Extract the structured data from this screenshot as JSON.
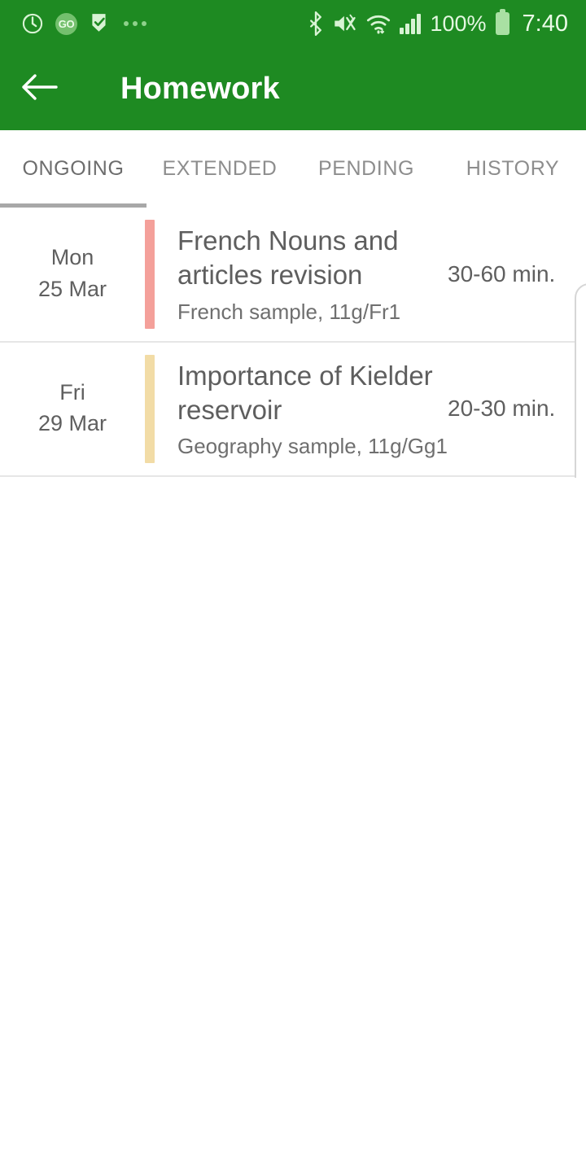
{
  "status_bar": {
    "left_icons": [
      {
        "name": "alarm-circle-icon",
        "glyph": "◎"
      },
      {
        "name": "go-badge-icon",
        "label": "GO"
      },
      {
        "name": "check-flag-icon",
        "glyph": "▶"
      },
      {
        "name": "more-dots-icon",
        "glyph": "•••"
      }
    ],
    "right_icons": [
      {
        "name": "bluetooth-icon",
        "glyph": "᛭"
      },
      {
        "name": "mute-vibrate-icon",
        "glyph": "🔇"
      },
      {
        "name": "wifi-icon",
        "glyph": "wifi"
      },
      {
        "name": "signal-bars-icon",
        "glyph": "bars"
      }
    ],
    "battery_percent": "100%",
    "time": "7:40"
  },
  "app_bar": {
    "back_label": "←",
    "title": "Homework"
  },
  "tabs": [
    {
      "label": "ONGOING",
      "active": true
    },
    {
      "label": "EXTENDED",
      "active": false
    },
    {
      "label": "PENDING",
      "active": false
    },
    {
      "label": "HISTORY",
      "active": false
    }
  ],
  "homework": [
    {
      "day": "Mon",
      "date": "25 Mar",
      "color": "#f4a09a",
      "title": "French Nouns and articles revision",
      "subtitle": "French sample, 11g/Fr1",
      "duration": "30-60 min."
    },
    {
      "day": "Fri",
      "date": "29 Mar",
      "color": "#f2dca6",
      "title": "Importance of Kielder reservoir",
      "subtitle": "Geography sample, 11g/Gg1",
      "duration": "20-30 min."
    }
  ],
  "theme": {
    "primary_green": "#1e8a22",
    "tab_indicator": "#a8a8a8",
    "divider": "#e6e6e6",
    "text_primary": "#5e5e5e",
    "text_secondary": "#8d8d8d"
  }
}
